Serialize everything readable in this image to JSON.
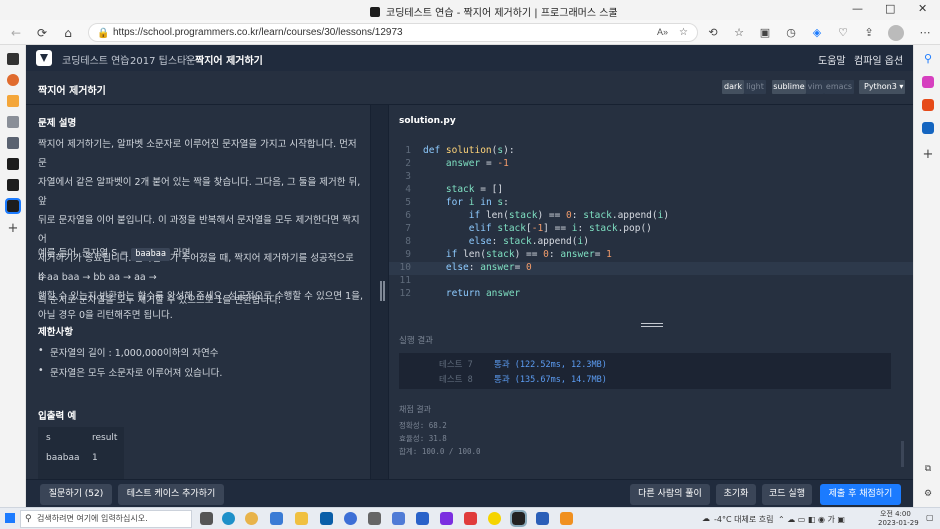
{
  "window": {
    "title": "코딩테스트 연습 - 짝지어 제거하기 | 프로그래머스 스쿨",
    "minimize": "—",
    "maximize": "□",
    "close": "✕"
  },
  "browser": {
    "url": "https://school.programmers.co.kr/learn/courses/30/lessons/12973",
    "back_icon": "←",
    "refresh_icon": "⟳",
    "home_icon": "⌂"
  },
  "header": {
    "crumb1": "코딩테스트 연습",
    "sep": "›",
    "crumb2": "2017 팁스타운",
    "crumb3": "짝지어 제거하기",
    "help": "도움말",
    "options": "컴파일 옵션"
  },
  "subheader": {
    "title": "짝지어 제거하기",
    "theme_dark": "dark",
    "theme_light": "light",
    "keymap_sublime": "sublime",
    "keymap_vim": "vim",
    "keymap_emacs": "emacs",
    "language": "Python3 ▾"
  },
  "problem": {
    "desc_title": "문제 설명",
    "desc_lines": [
      "짝지어 제거하기는, 알파벳 소문자로 이루어진 문자열을 가지고 시작합니다. 먼저 문",
      "자열에서 같은 알파벳이 2개 붙어 있는 짝을 찾습니다. 그다음, 그 둘을 제거한 뒤, 앞",
      "뒤로 문자열을 이어 붙입니다. 이 과정을 반복해서 문자열을 모두 제거한다면 짝지어",
      "제거하기가 종료됩니다. 문자열 S가 주어졌을 때, 짝지어 제거하기를 성공적으로 수",
      "행할 수 있는지 반환하는 함수를 완성해 주세요. 성공적으로 수행할 수 있으면 1을,",
      "아닐 경우 0을 리턴해주면 됩니다."
    ],
    "example_prefix": "예를 들어, 문자열 S =",
    "example_code": "baabaa",
    "example_suffix": "라면",
    "steps": "b aa baa → bb aa → aa →",
    "conclusion": "의 순서로 문자열을 모두 제거할 수 있으므로 1을 반환합니다.",
    "constraints_title": "제한사항",
    "constraints": [
      "문자열의 길이 : 1,000,000이하의 자연수",
      "문자열은 모두 소문자로 이루어져 있습니다."
    ],
    "io_title": "입출력 예",
    "io_headers": [
      "s",
      "result"
    ],
    "io_row1": [
      "baabaa",
      "1"
    ]
  },
  "editor": {
    "filename": "solution.py",
    "lines": [
      {
        "n": "1",
        "parts": [
          [
            "kw",
            "def "
          ],
          [
            "fn",
            "solution"
          ],
          [
            "",
            "("
          ],
          [
            "var",
            "s"
          ],
          [
            "",
            "):"
          ]
        ]
      },
      {
        "n": "2",
        "parts": [
          [
            "",
            "    "
          ],
          [
            "var",
            "answer"
          ],
          [
            "",
            " = "
          ],
          [
            "num",
            "-1"
          ]
        ]
      },
      {
        "n": "3",
        "parts": []
      },
      {
        "n": "4",
        "parts": [
          [
            "",
            "    "
          ],
          [
            "var",
            "stack"
          ],
          [
            "",
            " = []"
          ]
        ]
      },
      {
        "n": "5",
        "parts": [
          [
            "",
            "    "
          ],
          [
            "kw",
            "for "
          ],
          [
            "var",
            "i"
          ],
          [
            "kw",
            " in "
          ],
          [
            "var",
            "s"
          ],
          [
            "",
            ":"
          ]
        ]
      },
      {
        "n": "6",
        "parts": [
          [
            "",
            "        "
          ],
          [
            "kw",
            "if "
          ],
          [
            "",
            "len("
          ],
          [
            "var",
            "stack"
          ],
          [
            "",
            ") == "
          ],
          [
            "num",
            "0"
          ],
          [
            "",
            ": "
          ],
          [
            "var",
            "stack"
          ],
          [
            "",
            ".append("
          ],
          [
            "var",
            "i"
          ],
          [
            "",
            ")"
          ]
        ]
      },
      {
        "n": "7",
        "parts": [
          [
            "",
            "        "
          ],
          [
            "kw",
            "elif "
          ],
          [
            "var",
            "stack"
          ],
          [
            "",
            "["
          ],
          [
            "num",
            "-1"
          ],
          [
            "",
            "] == "
          ],
          [
            "var",
            "i"
          ],
          [
            "",
            ": "
          ],
          [
            "var",
            "stack"
          ],
          [
            "",
            ".pop()"
          ]
        ]
      },
      {
        "n": "8",
        "parts": [
          [
            "",
            "        "
          ],
          [
            "kw",
            "else"
          ],
          [
            "",
            ": "
          ],
          [
            "var",
            "stack"
          ],
          [
            "",
            ".append("
          ],
          [
            "var",
            "i"
          ],
          [
            "",
            ")"
          ]
        ]
      },
      {
        "n": "9",
        "parts": [
          [
            "",
            "    "
          ],
          [
            "kw",
            "if "
          ],
          [
            "",
            "len("
          ],
          [
            "var",
            "stack"
          ],
          [
            "",
            ") == "
          ],
          [
            "num",
            "0"
          ],
          [
            "",
            ": "
          ],
          [
            "var",
            "answer"
          ],
          [
            "",
            "= "
          ],
          [
            "num",
            "1"
          ]
        ]
      },
      {
        "n": "10",
        "parts": [
          [
            "",
            "    "
          ],
          [
            "kw",
            "else"
          ],
          [
            "",
            ": "
          ],
          [
            "var",
            "answer"
          ],
          [
            "",
            "= "
          ],
          [
            "num",
            "0"
          ]
        ]
      },
      {
        "n": "11",
        "parts": []
      },
      {
        "n": "12",
        "parts": [
          [
            "",
            "    "
          ],
          [
            "kw",
            "return "
          ],
          [
            "var",
            "answer"
          ]
        ]
      }
    ]
  },
  "results": {
    "title": "실행 결과",
    "test7_label": "테스트 7",
    "test7_result": "통과 (122.52ms, 12.3MB)",
    "test8_label": "테스트 8",
    "test8_result": "통과 (135.67ms, 14.7MB)",
    "score_title": "채점 결과",
    "accuracy": "정확성: 68.2",
    "efficiency": "효율성: 31.8",
    "total": "합계: 100.0 / 100.0"
  },
  "actions": {
    "question": "질문하기 (52)",
    "add_testcase": "테스트 케이스 추가하기",
    "others": "다른 사람의 풀이",
    "reset": "초기화",
    "run": "코드 실행",
    "submit": "제출 후 채점하기"
  },
  "taskbar": {
    "search_placeholder": "검색하려면 여기에 입력하십시오.",
    "weather": "-4°C 대체로 흐림",
    "time": "오전 4:00",
    "date": "2023-01-29"
  },
  "colors": {
    "header_bg": "#202b3d",
    "panel_bg": "#263040",
    "submit_bg": "#1b7bff",
    "pass_text": "#5c9cf2"
  }
}
